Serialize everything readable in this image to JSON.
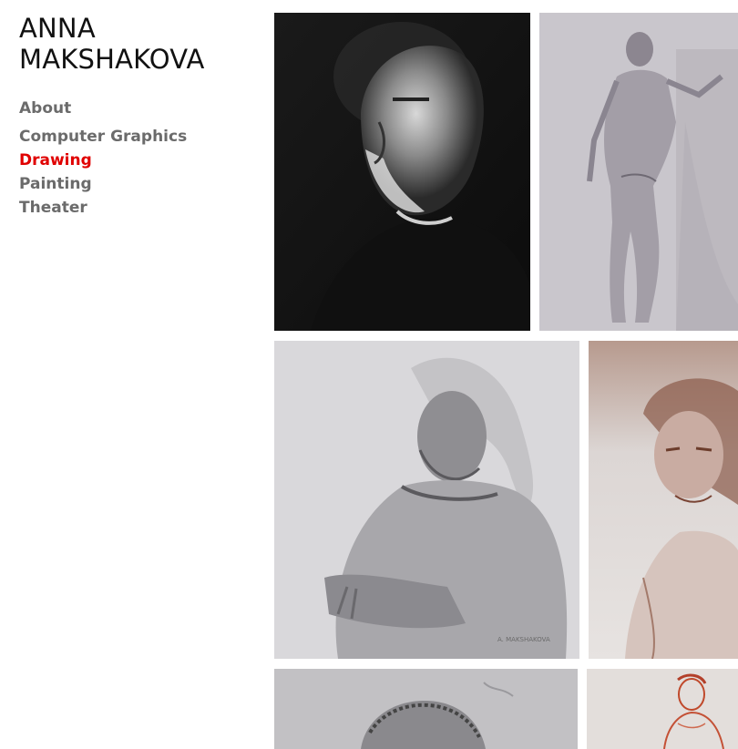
{
  "site": {
    "title_line1": "ANNA",
    "title_line2": "MAKSHAKOVA"
  },
  "nav": {
    "items": [
      {
        "label": "About"
      },
      {
        "label": "Computer Graphics"
      },
      {
        "label": "Drawing"
      },
      {
        "label": "Painting"
      },
      {
        "label": "Theater"
      }
    ],
    "active": "Drawing",
    "active_color": "#e00000",
    "inactive_color": "#6b6b6b"
  },
  "gallery": {
    "tiles": [
      {
        "subject": "charcoal portrait of elderly bearded man",
        "tone": "dark"
      },
      {
        "subject": "standing male nude figure study",
        "tone": "grey"
      },
      {
        "subject": "seated old man with long hair, pencil",
        "tone": "light-grey"
      },
      {
        "subject": "sanguine portrait of young woman",
        "tone": "sepia"
      },
      {
        "subject": "portrait with curly hair, pencil",
        "tone": "grey"
      },
      {
        "subject": "sanguine female figure sketch",
        "tone": "red"
      }
    ]
  }
}
